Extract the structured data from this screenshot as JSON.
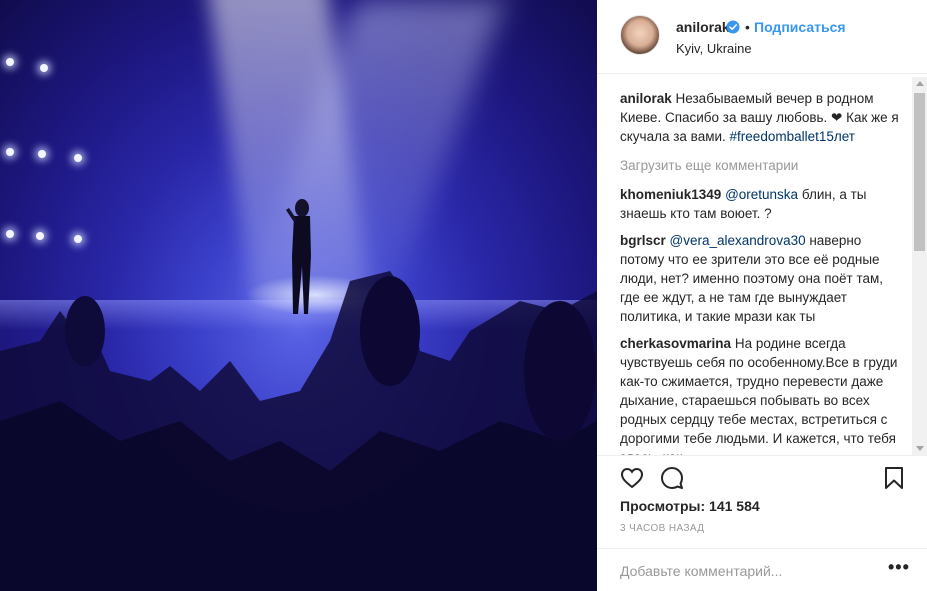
{
  "post": {
    "username": "anilorak",
    "follow_label": "Подписаться",
    "separator": "•",
    "location": "Kyiv, Ukraine"
  },
  "caption": {
    "username": "anilorak",
    "text": " Незабываемый вечер в родном Киеве. Спасибо за вашу любовь. ❤ Как же я скучала за вами. ",
    "hashtag": "#freedomballet15лет"
  },
  "load_more_label": "Загрузить еще комментарии",
  "comments": [
    {
      "username": "khomeniuk1349",
      "mention": "@oretunska",
      "text": " блин, а ты знаешь кто там воюет. ?"
    },
    {
      "username": "bgrlscr",
      "mention": "@vera_alexandrova30",
      "text": " наверно потому что ее зрители это все её родные люди, нет? именно поэтому она поёт там, где ее ждут, а не там где вынуждает политика, и такие мрази как ты"
    },
    {
      "username": "cherkasovmarina",
      "mention": "",
      "text": " На родине всегда чувствуешь себя по особенному.Все в груди как-то сжимается, трудно перевести даже дыхание, стараешься побывать во всех родных сердцу тебе местах, встретиться с дорогими тебе людьми. И кажется, что тебя здесь, как"
    }
  ],
  "stats": {
    "views": "Просмотры: 141 584",
    "timestamp": "3 ЧАСОВ НАЗАД"
  },
  "add_comment": {
    "placeholder": "Добавьте комментарий...",
    "more_label": "•••"
  },
  "icons": {
    "verified": "verified-badge-icon",
    "like": "heart-icon",
    "comment": "comment-bubble-icon",
    "save": "bookmark-icon",
    "options": "more-options-icon"
  },
  "colors": {
    "link": "#3897f0",
    "hashtag": "#003569",
    "muted": "#999999",
    "text": "#262626"
  }
}
